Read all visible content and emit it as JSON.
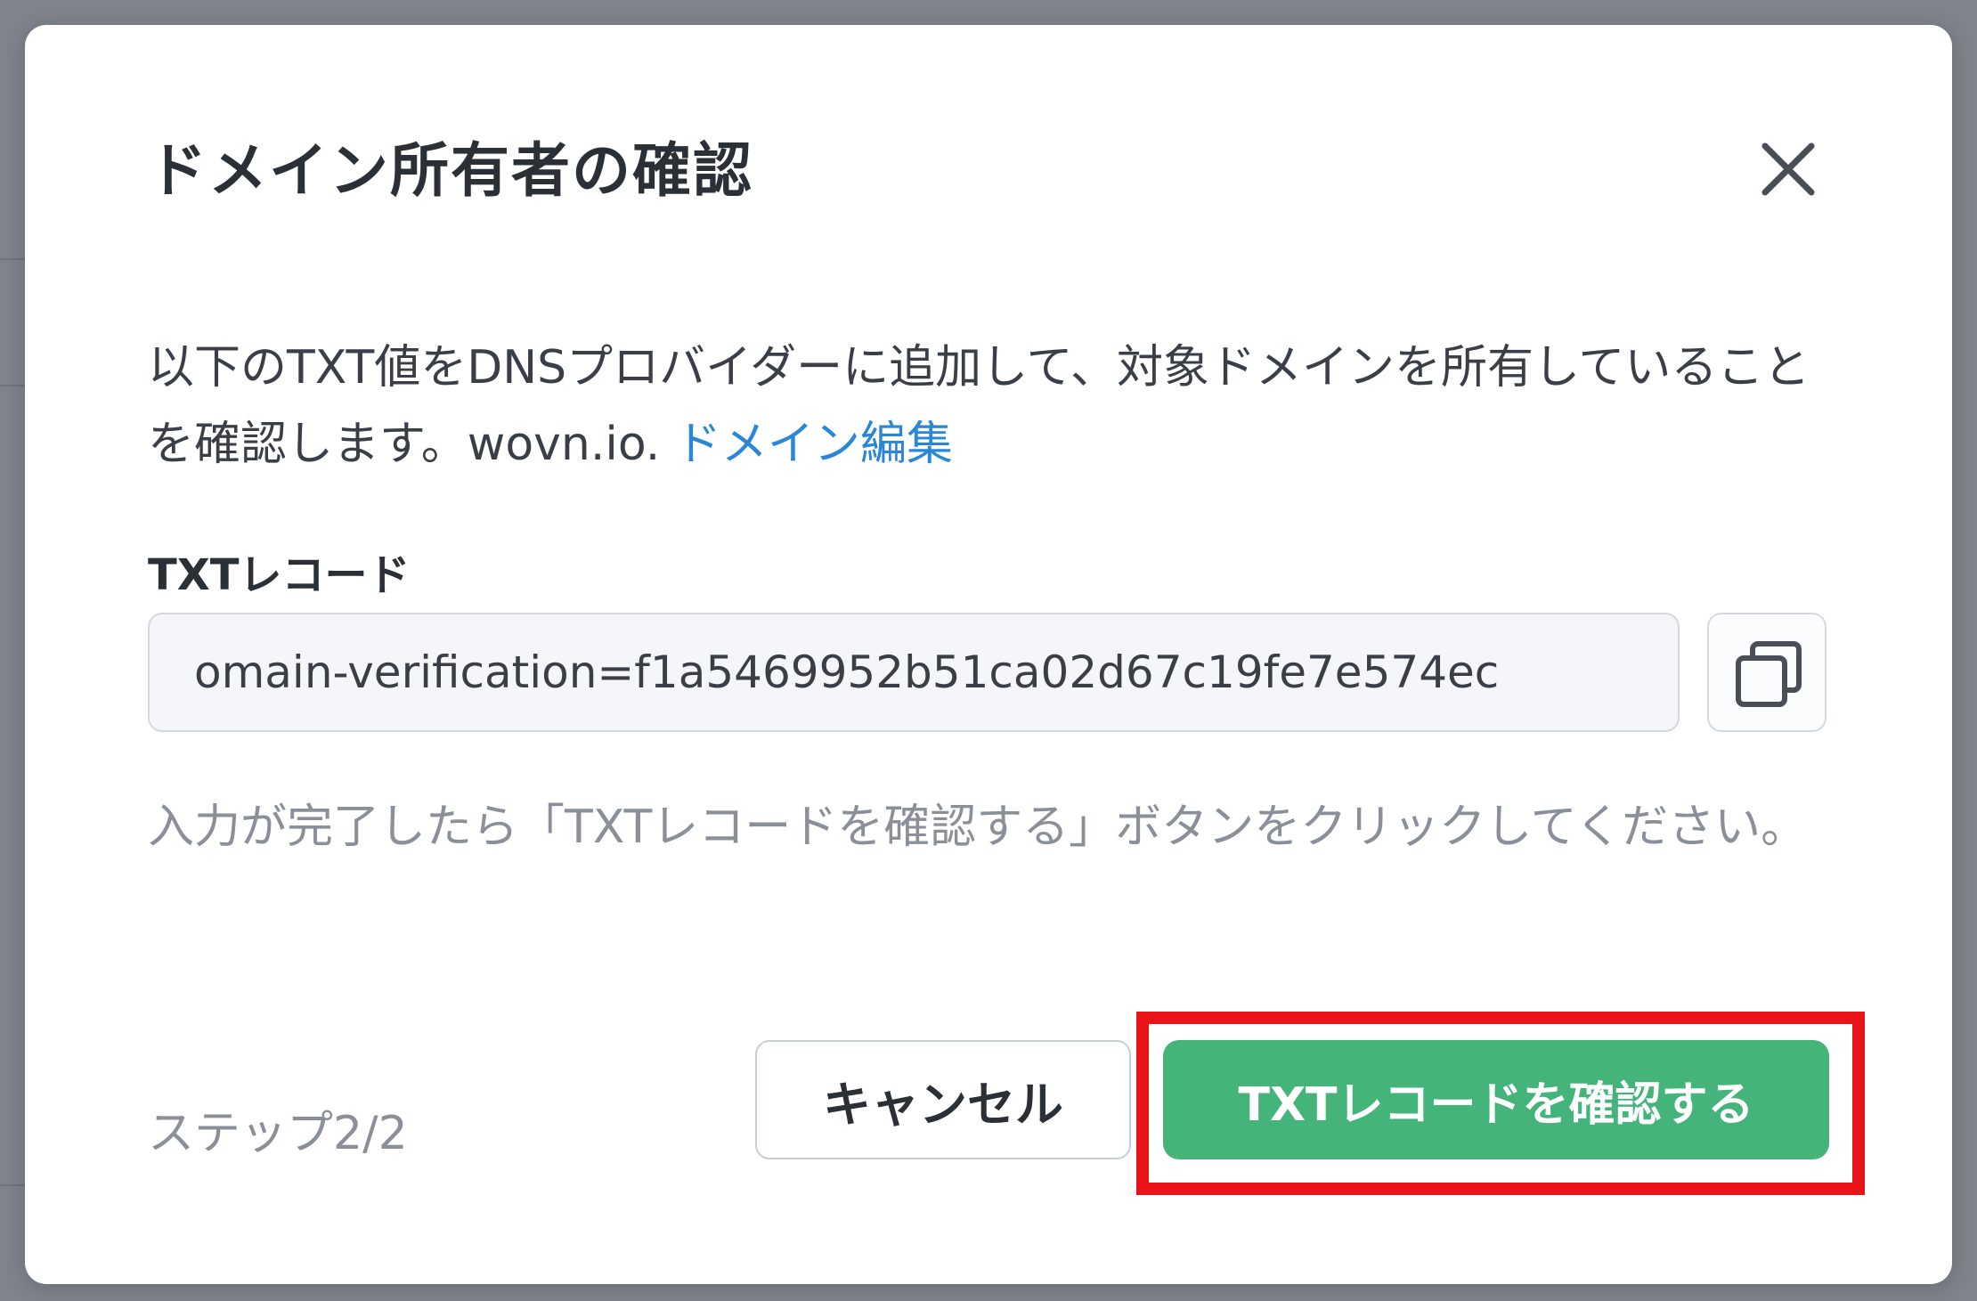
{
  "dialog": {
    "title": "ドメイン所有者の確認",
    "close_icon": "close-icon",
    "description_text": "以下のTXT値をDNSプロバイダーに追加して、対象ドメインを所有していることを確認します。wovn.io. ",
    "description_link": "ドメイン編集",
    "field_label": "TXTレコード",
    "txt_value": "omain-verification=f1a5469952b51ca02d67c19fe7e574ec",
    "copy_icon": "copy-icon",
    "hint": "入力が完了したら「TXTレコードを確認する」ボタンをクリックしてください。",
    "step": "ステップ2/2",
    "cancel_label": "キャンセル",
    "confirm_label": "TXTレコードを確認する"
  },
  "colors": {
    "accent_green": "#44b47b",
    "link_blue": "#2a86d6",
    "highlight_red": "#e8141a",
    "backdrop": "#7f838b"
  }
}
